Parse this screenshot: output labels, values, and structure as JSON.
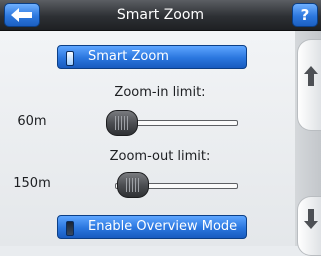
{
  "header": {
    "title": "Smart Zoom",
    "back_icon": "arrow-left-icon",
    "help_label": "?"
  },
  "toggles": {
    "smart_zoom": {
      "label": "Smart Zoom",
      "state": "on"
    },
    "overview_mode": {
      "label": "Enable Overview Mode",
      "state": "off"
    }
  },
  "zoom_in": {
    "caption": "Zoom-in limit:",
    "value": "60m",
    "level": 0.06
  },
  "zoom_out": {
    "caption": "Zoom-out limit:",
    "value": "150m",
    "level": 0.15
  },
  "scroll": {
    "up_icon": "arrow-up-icon",
    "down_icon": "arrow-down-icon"
  },
  "colors": {
    "accent_blue": "#2a76de",
    "titlebar_dark": "#2d3034"
  }
}
